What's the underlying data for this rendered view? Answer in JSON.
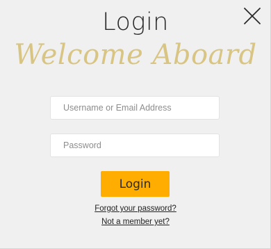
{
  "dialog": {
    "title": "Login",
    "welcome_text": "Welcome Aboard",
    "close_icon": "close-icon"
  },
  "form": {
    "username_placeholder": "Username or Email Address",
    "username_value": "",
    "password_placeholder": "Password",
    "password_value": "",
    "submit_label": "Login"
  },
  "links": {
    "forgot_password": "Forgot your password?",
    "not_member": "Not a member yet?"
  },
  "colors": {
    "background": "#f0f0f0",
    "accent": "#ffad00",
    "welcome_gold": "#d8c583",
    "title_text": "#2a2a2a"
  }
}
